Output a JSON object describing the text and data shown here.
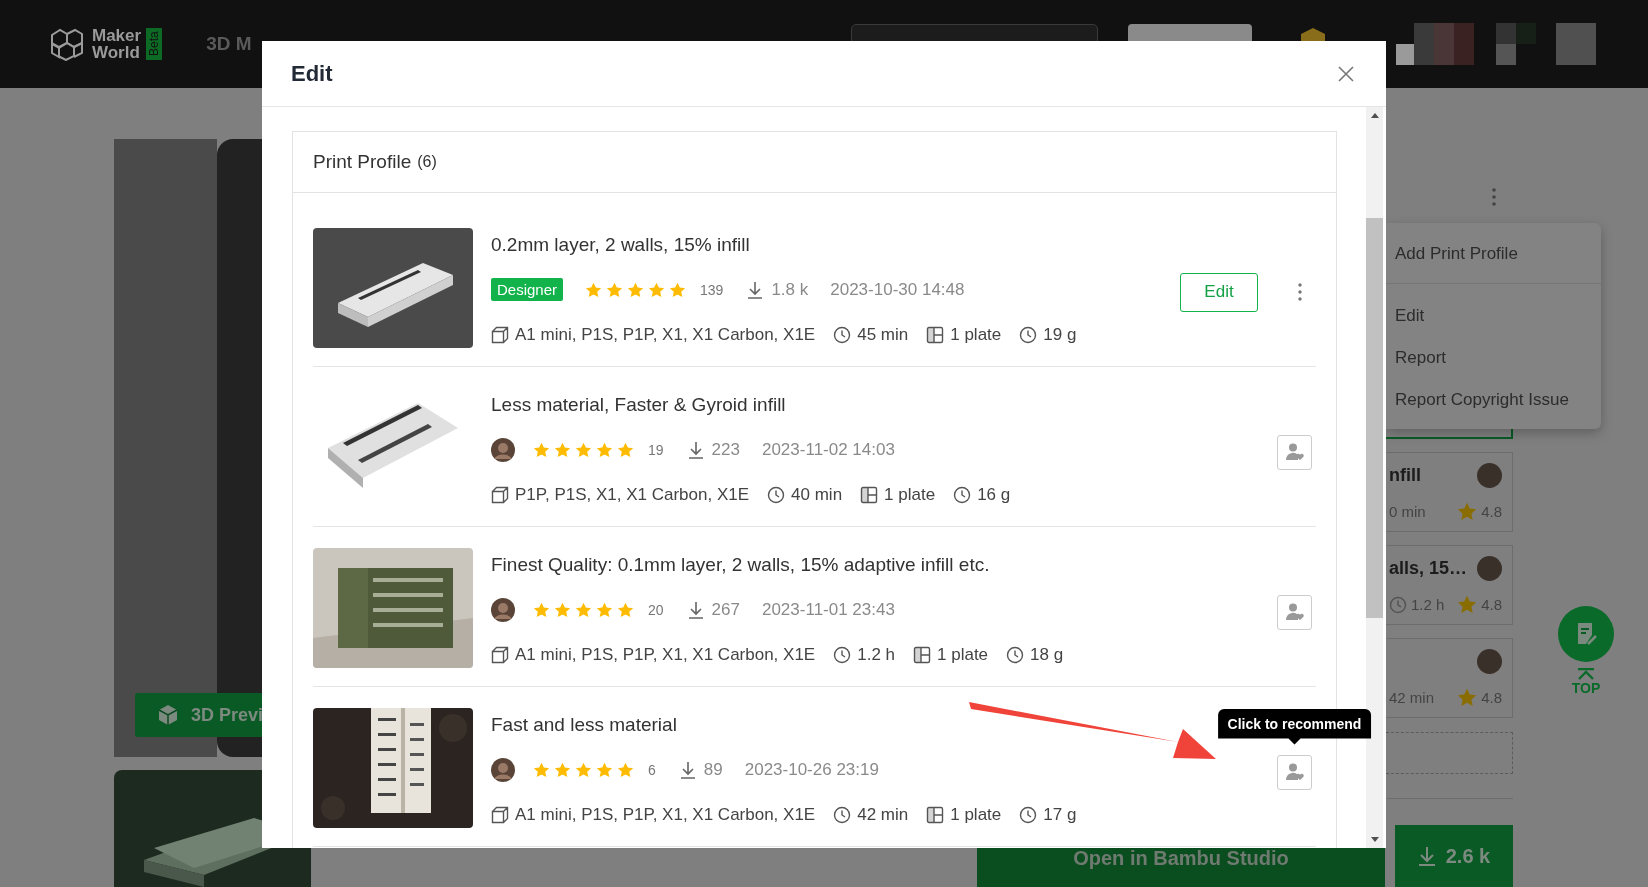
{
  "header": {
    "logo_top": "Maker",
    "logo_bottom": "World",
    "logo_badge": "Beta",
    "nav_item": "3D M"
  },
  "gallery": {
    "preview_button": "3D Previ"
  },
  "side_menu": {
    "groups": [
      [
        "Add Print Profile"
      ],
      [
        "Edit",
        "Report",
        "Report Copyright Issue"
      ]
    ]
  },
  "side_profiles": [
    {
      "title": "nfill",
      "time": "0 min",
      "clock_icon": false,
      "rating": "4.8"
    },
    {
      "title": "alls, 15…",
      "time": "1.2 h",
      "clock_icon": true,
      "rating": "4.8"
    },
    {
      "time": "42 min",
      "clock_icon": false,
      "rating": "4.8"
    }
  ],
  "actions": {
    "open_button": "Open in Bambu Studio",
    "download_count": "2.6 k"
  },
  "float_top": "TOP",
  "modal": {
    "title": "Edit",
    "section_title": "Print Profile",
    "section_count": "(6)",
    "profiles": [
      {
        "title": "0.2mm layer, 2 walls, 15% infill",
        "badge": "Designer",
        "stars": 5,
        "rating_count": "139",
        "downloads": "1.8 k",
        "date": "2023-10-30 14:48",
        "printers": "A1 mini, P1S, P1P, X1, X1 Carbon, X1E",
        "time": "45 min",
        "plates": "1 plate",
        "weight": "19 g",
        "action": {
          "kind": "edit",
          "label": "Edit"
        }
      },
      {
        "title": "Less material, Faster & Gyroid infill",
        "stars": 5,
        "rating_count": "19",
        "downloads": "223",
        "date": "2023-11-02 14:03",
        "printers": "P1P, P1S, X1, X1 Carbon, X1E",
        "time": "40 min",
        "plates": "1 plate",
        "weight": "16 g",
        "action": {
          "kind": "recommend"
        }
      },
      {
        "title": "Finest Quality: 0.1mm layer, 2 walls, 15% adaptive infill etc.",
        "stars": 5,
        "rating_count": "20",
        "downloads": "267",
        "date": "2023-11-01 23:43",
        "printers": "A1 mini, P1S, P1P, X1, X1 Carbon, X1E",
        "time": "1.2 h",
        "plates": "1 plate",
        "weight": "18 g",
        "action": {
          "kind": "recommend"
        }
      },
      {
        "title": "Fast and less material",
        "stars": 5,
        "rating_count": "6",
        "downloads": "89",
        "date": "2023-10-26 23:19",
        "printers": "A1 mini, P1S, P1P, X1, X1 Carbon, X1E",
        "time": "42 min",
        "plates": "1 plate",
        "weight": "17 g",
        "action": {
          "kind": "recommend",
          "tooltip": "Click to recommend"
        }
      }
    ]
  }
}
